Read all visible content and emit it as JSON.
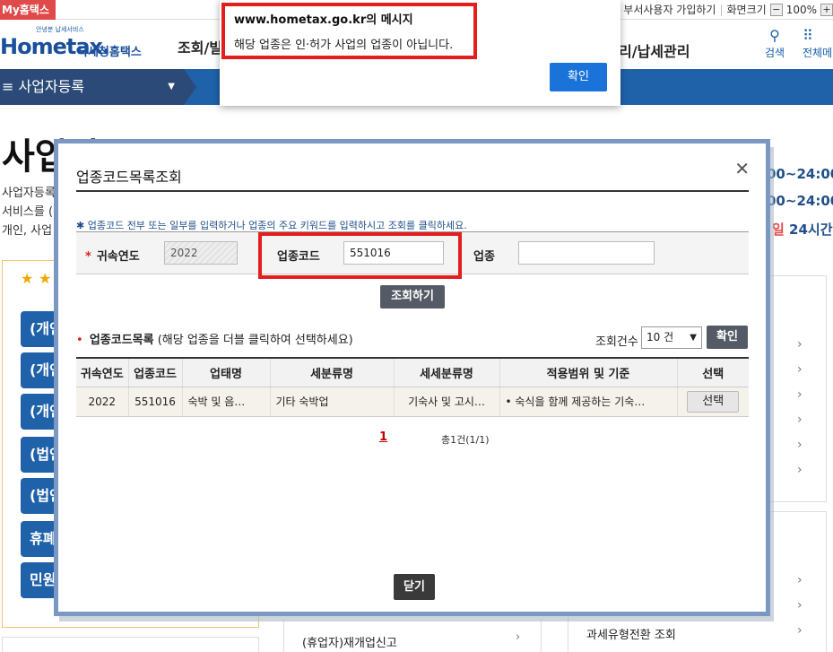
{
  "topbar": {
    "my_tab": "My홈택스",
    "links": [
      "부서사용자 가입하기",
      "화면크기"
    ],
    "zoom_minus": "−",
    "zoom_value": "100%",
    "zoom_plus": "+"
  },
  "header": {
    "logo_small": "안녕분 납세서비스",
    "logo_main": "Hometax.",
    "logo_sub": "국세청홈택스",
    "nav_left": "조회/빌",
    "nav_right": "리/납세관리",
    "search_label": "검색",
    "all_menu_label": "전체메"
  },
  "menu": {
    "label": "≡  사업자등록",
    "caret": "▼"
  },
  "page": {
    "title": "사업자등록",
    "desc_lines": [
      "사업자등록",
      "서비스를 (",
      "개인, 사업"
    ],
    "hours": [
      "00~24:00",
      "00~24:00"
    ],
    "hours_note_red": "일",
    "hours_note_blue": "24시간"
  },
  "left_buttons": [
    "(개인",
    "(개인",
    "(개인",
    "(법인",
    "(법인",
    "휴폐",
    "민원"
  ],
  "right_bottom": {
    "item": "과세유형전환 조회",
    "mid_item": "(휴업자)재개업신고"
  },
  "modal": {
    "title": "업종코드목록조회",
    "close": "✕",
    "notice": "✱ 업종코드 전부 또는 일부를 입력하거나 업종의 주요 키워드를 입력하시고 조회를 클릭하세요.",
    "year_label": "귀속연도",
    "year_value": "2022",
    "code_label": "업종코드",
    "code_value": "551016",
    "industry_label": "업종",
    "industry_value": "",
    "search_button": "조회하기",
    "list_title": "업종코드목록",
    "list_hint": "(해당 업종을 더블 클릭하여 선택하세요)",
    "count_label": "조회건수",
    "count_value": "10 건",
    "count_confirm": "확인",
    "columns": [
      "귀속연도",
      "업종코드",
      "업태명",
      "세분류명",
      "세세분류명",
      "적용범위 및 기준",
      "선택"
    ],
    "rows": [
      {
        "year": "2022",
        "code": "551016",
        "business": "숙박 및 음…",
        "sub": "기타 숙박업",
        "subsub": "기숙사 및 고시…",
        "scope": "• 숙식을 함께 제공하는 기숙…",
        "select": "선택"
      }
    ],
    "page_current": "1",
    "page_total": "총1건(1/1)",
    "close_button": "닫기"
  },
  "alert": {
    "title": "www.hometax.go.kr의 메시지",
    "message": "해당 업종은 인·허가 사업의 업종이 아닙니다.",
    "ok": "확인"
  },
  "colors": {
    "brand_blue": "#1f62aa",
    "alert_button": "#1a73d9",
    "highlight_red": "#e41e1e"
  }
}
